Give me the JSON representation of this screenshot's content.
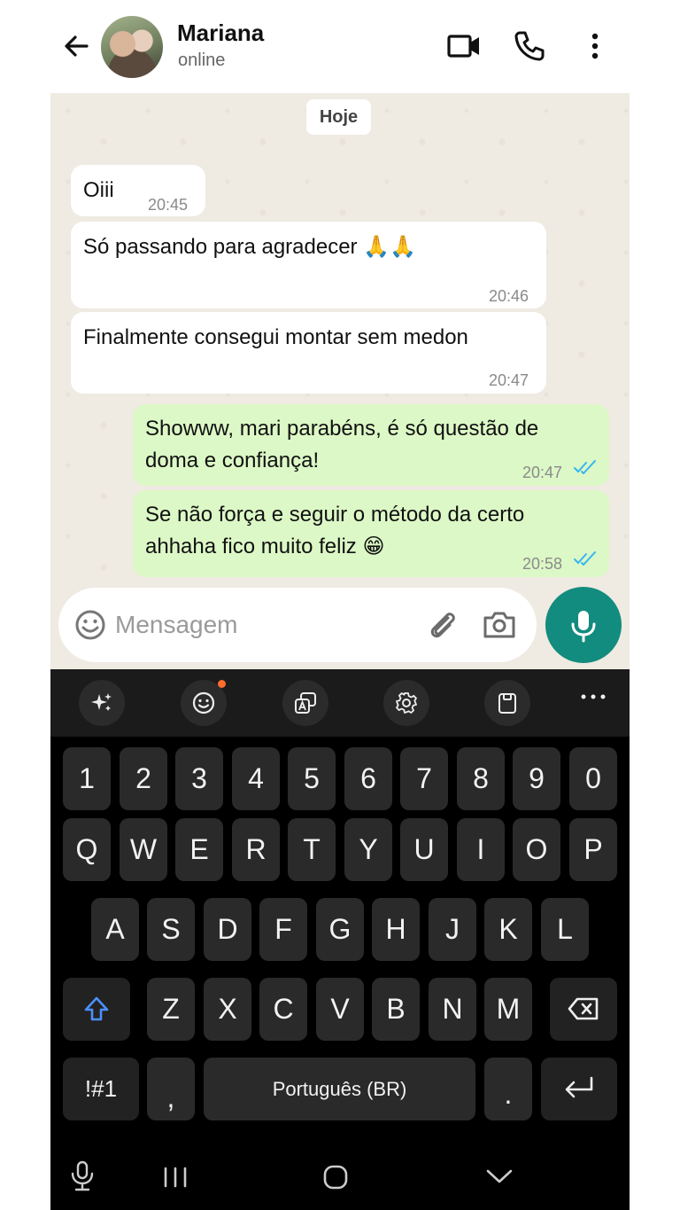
{
  "header": {
    "contact_name": "Mariana",
    "status": "online",
    "icons": [
      "back-arrow-icon",
      "video-call-icon",
      "voice-call-icon",
      "more-vert-icon"
    ]
  },
  "chat": {
    "date_chip": "Hoje",
    "messages": [
      {
        "direction": "in",
        "lines": [
          "Oiii"
        ],
        "time": "20:45"
      },
      {
        "direction": "in",
        "lines": [
          "Só passando para agradecer 🙏🙏"
        ],
        "time": "20:46"
      },
      {
        "direction": "in",
        "lines": [
          "Finalmente consegui montar sem medon"
        ],
        "time": "20:47"
      },
      {
        "direction": "out",
        "lines": [
          "Showww, mari parabéns,  é só questão de",
          "doma e confiança!"
        ],
        "time": "20:47",
        "read": true
      },
      {
        "direction": "out",
        "lines": [
          "Se não força e seguir o método da certo",
          "ahhaha fico muito feliz 😁"
        ],
        "time": "20:58",
        "read": true
      }
    ]
  },
  "composer": {
    "placeholder": "Mensagem",
    "value": ""
  },
  "keyboard": {
    "toolbar_icons": [
      "sparkle-icon",
      "emoji-icon",
      "translate-icon",
      "settings-icon",
      "clipboard-icon",
      "more-horiz-icon"
    ],
    "row_numbers": [
      "1",
      "2",
      "3",
      "4",
      "5",
      "6",
      "7",
      "8",
      "9",
      "0"
    ],
    "row_top": [
      "Q",
      "W",
      "E",
      "R",
      "T",
      "Y",
      "U",
      "I",
      "O",
      "P"
    ],
    "row_home": [
      "A",
      "S",
      "D",
      "F",
      "G",
      "H",
      "J",
      "K",
      "L"
    ],
    "row_bottom": [
      "Z",
      "X",
      "C",
      "V",
      "B",
      "N",
      "M"
    ],
    "symbols_key": "!#1",
    "comma_key": ",",
    "space_label": "Português (BR)",
    "period_key": "."
  },
  "colors": {
    "chat_bg": "#efeae2",
    "outgoing_bubble": "#dcf8c6",
    "accent_fab": "#128c7e",
    "read_ticks": "#34b7f1",
    "shift_active": "#4a90ff"
  }
}
